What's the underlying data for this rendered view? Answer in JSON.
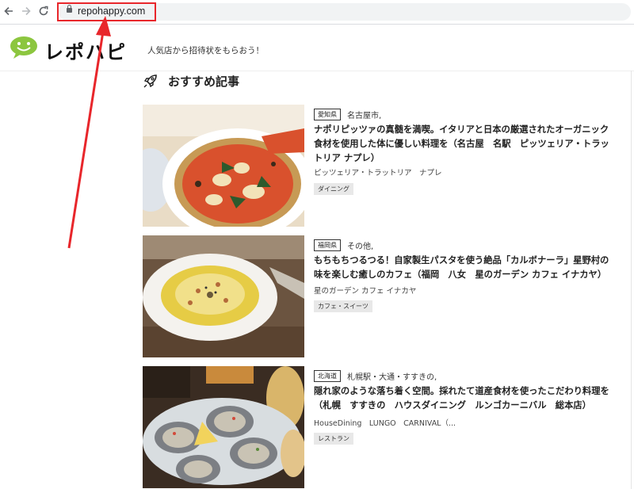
{
  "browser": {
    "back_icon": "back-arrow-icon",
    "forward_icon": "forward-arrow-icon",
    "reload_icon": "reload-icon",
    "url": "repohappy.com"
  },
  "site": {
    "logo": "レポハピ",
    "tagline": "人気店から招待状をもらおう！"
  },
  "section": {
    "icon": "rocket-icon",
    "title": "おすすめ記事"
  },
  "articles": [
    {
      "prefecture": "愛知県",
      "area": "名古屋市,",
      "title": "ナポリピッツァの真髄を満喫。イタリアと日本の厳選されたオーガニック食材を使用した体に優しい料理を（名古屋　名駅　ピッツェリア・トラットリア ナプレ）",
      "shop": "ピッツェリア・トラットリア　ナプレ",
      "genre": "ダイニング"
    },
    {
      "prefecture": "福岡県",
      "area": "その他,",
      "title": "もちもちつるつる！自家製生パスタを使う絶品「カルボナーラ」星野村の味を楽しむ癒しのカフェ（福岡　八女　星のガーデン カフェ イナカヤ）",
      "shop": "星のガーデン カフェ イナカヤ",
      "genre": "カフェ・スイーツ"
    },
    {
      "prefecture": "北海道",
      "area": "札幌駅・大通・すすきの,",
      "title": "隠れ家のような落ち着く空間。採れたて道産食材を使ったこだわり料理を（札幌　すすきの　ハウスダイニング　ルンゴカーニバル　総本店）",
      "shop": "HouseDining　LUNGO　CARNIVAL（...",
      "genre": "レストラン"
    }
  ],
  "colors": {
    "annotation_red": "#e8262b",
    "logo_green": "#8cc63f"
  }
}
